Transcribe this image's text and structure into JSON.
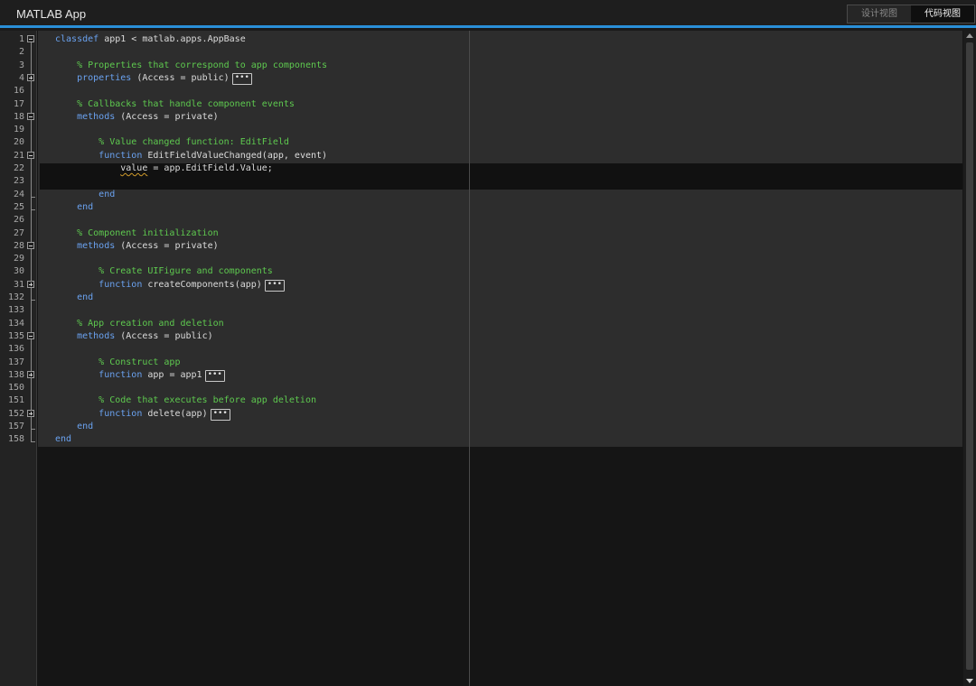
{
  "window": {
    "title": "MATLAB App"
  },
  "view_switch": {
    "design_view_label": "设计视图",
    "code_view_label": "代码视图",
    "active": "code"
  },
  "editor": {
    "colors": {
      "keyword": "#6aa2f0",
      "comment": "#5ec94f",
      "text": "#dcdcdc",
      "accent": "#2a8fd8"
    },
    "current_line": "22",
    "lines": [
      {
        "num": "1",
        "fold": "minus",
        "parts": [
          {
            "t": "classdef",
            "c": "kw"
          },
          {
            "t": " app1 < matlab.apps.AppBase",
            "c": ""
          }
        ]
      },
      {
        "num": "2",
        "fold": "",
        "parts": []
      },
      {
        "num": "3",
        "fold": "",
        "parts": [
          {
            "t": "    % Properties that correspond to app components",
            "c": "cm"
          }
        ]
      },
      {
        "num": "4",
        "fold": "plus",
        "ellipsis": true,
        "parts": [
          {
            "t": "    ",
            "c": ""
          },
          {
            "t": "properties",
            "c": "kw"
          },
          {
            "t": " (Access = public)",
            "c": ""
          }
        ]
      },
      {
        "num": "16",
        "fold": "",
        "parts": []
      },
      {
        "num": "17",
        "fold": "",
        "parts": [
          {
            "t": "    % Callbacks that handle component events",
            "c": "cm"
          }
        ]
      },
      {
        "num": "18",
        "fold": "minus",
        "parts": [
          {
            "t": "    ",
            "c": ""
          },
          {
            "t": "methods",
            "c": "kw"
          },
          {
            "t": " (Access = private)",
            "c": ""
          }
        ]
      },
      {
        "num": "19",
        "fold": "",
        "parts": []
      },
      {
        "num": "20",
        "fold": "",
        "parts": [
          {
            "t": "        % Value changed function: EditField",
            "c": "cm"
          }
        ]
      },
      {
        "num": "21",
        "fold": "minus",
        "parts": [
          {
            "t": "        ",
            "c": ""
          },
          {
            "t": "function",
            "c": "kw"
          },
          {
            "t": " EditFieldValueChanged(app, event)",
            "c": ""
          }
        ]
      },
      {
        "num": "22",
        "fold": "",
        "parts": [
          {
            "t": "            ",
            "c": ""
          },
          {
            "t": "value",
            "c": "wavy"
          },
          {
            "t": " = app.EditField.Value;",
            "c": ""
          }
        ]
      },
      {
        "num": "23",
        "fold": "",
        "parts": []
      },
      {
        "num": "24",
        "fold": "",
        "parts": [
          {
            "t": "        ",
            "c": ""
          },
          {
            "t": "end",
            "c": "kw"
          }
        ]
      },
      {
        "num": "25",
        "fold": "",
        "parts": [
          {
            "t": "    ",
            "c": ""
          },
          {
            "t": "end",
            "c": "kw"
          }
        ]
      },
      {
        "num": "26",
        "fold": "",
        "parts": []
      },
      {
        "num": "27",
        "fold": "",
        "parts": [
          {
            "t": "    % Component initialization",
            "c": "cm"
          }
        ]
      },
      {
        "num": "28",
        "fold": "minus",
        "parts": [
          {
            "t": "    ",
            "c": ""
          },
          {
            "t": "methods",
            "c": "kw"
          },
          {
            "t": " (Access = private)",
            "c": ""
          }
        ]
      },
      {
        "num": "29",
        "fold": "",
        "parts": []
      },
      {
        "num": "30",
        "fold": "",
        "parts": [
          {
            "t": "        % Create UIFigure and components",
            "c": "cm"
          }
        ]
      },
      {
        "num": "31",
        "fold": "plus",
        "ellipsis": true,
        "parts": [
          {
            "t": "        ",
            "c": ""
          },
          {
            "t": "function",
            "c": "kw"
          },
          {
            "t": " createComponents(app)",
            "c": ""
          }
        ]
      },
      {
        "num": "132",
        "fold": "",
        "parts": [
          {
            "t": "    ",
            "c": ""
          },
          {
            "t": "end",
            "c": "kw"
          }
        ]
      },
      {
        "num": "133",
        "fold": "",
        "parts": []
      },
      {
        "num": "134",
        "fold": "",
        "parts": [
          {
            "t": "    % App creation and deletion",
            "c": "cm"
          }
        ]
      },
      {
        "num": "135",
        "fold": "minus",
        "parts": [
          {
            "t": "    ",
            "c": ""
          },
          {
            "t": "methods",
            "c": "kw"
          },
          {
            "t": " (Access = public)",
            "c": ""
          }
        ]
      },
      {
        "num": "136",
        "fold": "",
        "parts": []
      },
      {
        "num": "137",
        "fold": "",
        "parts": [
          {
            "t": "        % Construct app",
            "c": "cm"
          }
        ]
      },
      {
        "num": "138",
        "fold": "plus",
        "ellipsis": true,
        "parts": [
          {
            "t": "        ",
            "c": ""
          },
          {
            "t": "function",
            "c": "kw"
          },
          {
            "t": " app = app1",
            "c": ""
          }
        ]
      },
      {
        "num": "150",
        "fold": "",
        "parts": []
      },
      {
        "num": "151",
        "fold": "",
        "parts": [
          {
            "t": "        % Code that executes before app deletion",
            "c": "cm"
          }
        ]
      },
      {
        "num": "152",
        "fold": "plus",
        "ellipsis": true,
        "parts": [
          {
            "t": "        ",
            "c": ""
          },
          {
            "t": "function",
            "c": "kw"
          },
          {
            "t": " delete(app)",
            "c": ""
          }
        ]
      },
      {
        "num": "157",
        "fold": "",
        "parts": [
          {
            "t": "    ",
            "c": ""
          },
          {
            "t": "end",
            "c": "kw"
          }
        ]
      },
      {
        "num": "158",
        "fold": "",
        "parts": [
          {
            "t": "end",
            "c": "kw"
          }
        ]
      }
    ],
    "ellipsis_label": "•••"
  }
}
